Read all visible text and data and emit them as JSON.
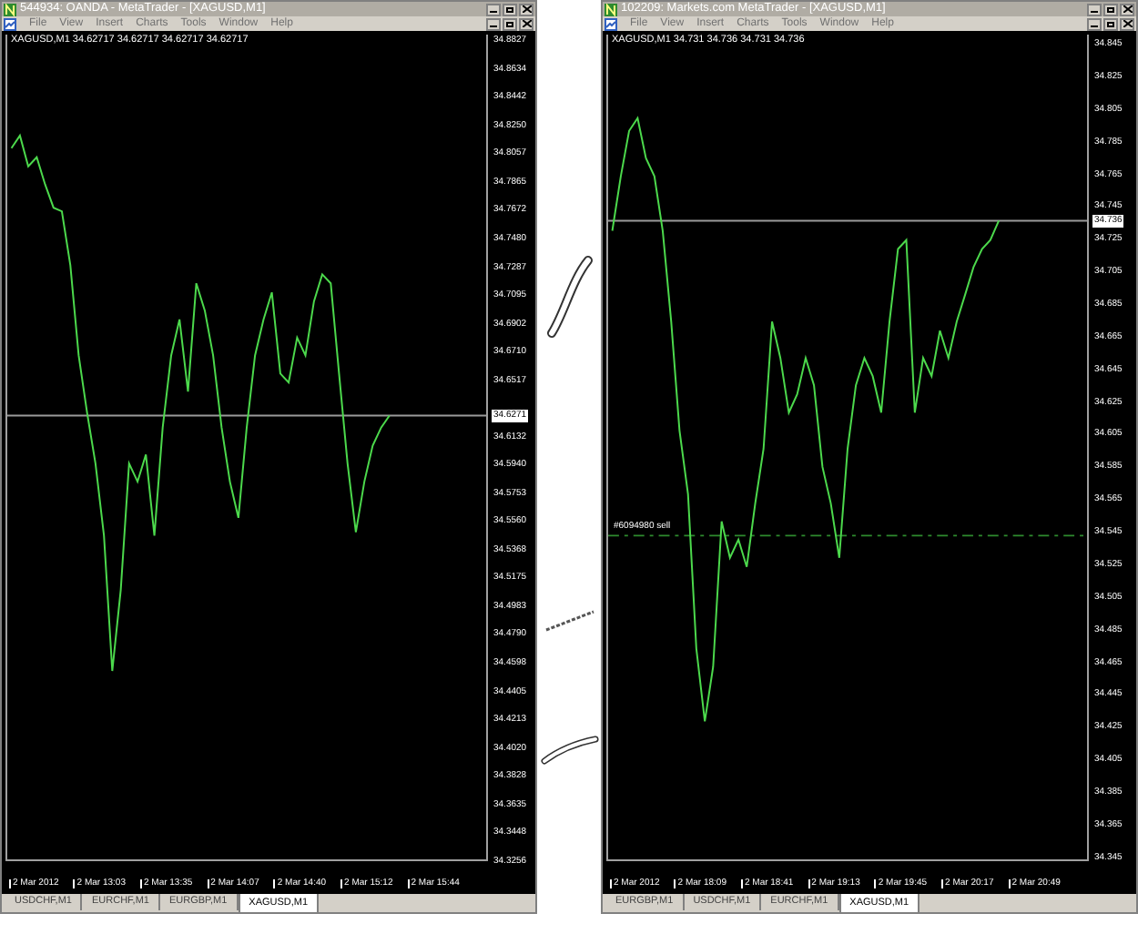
{
  "windows": [
    {
      "title": "544934: OANDA - MetaTrader - [XAGUSD,M1]",
      "menu": [
        "File",
        "View",
        "Insert",
        "Charts",
        "Tools",
        "Window",
        "Help"
      ],
      "chart_ohlc": "34.62717 34.62717 34.62717 34.62717",
      "time_labels": [
        "2 Mar 2012",
        "2 Mar 13:03",
        "2 Mar 13:35",
        "2 Mar 14:07",
        "2 Mar 14:40",
        "2 Mar 15:12",
        "2 Mar 15:44"
      ],
      "chart_data": {
        "type": "line",
        "ylim": [
          34.325,
          34.8864
        ],
        "ref_lines": [
          {
            "axis": "y",
            "value": 34.6271,
            "label": "34.6271",
            "color": "#9a9a9a"
          }
        ],
        "series": [
          {
            "name": "XAGUSD,M1",
            "color": "#4cd94c",
            "values": [
              34.8091,
              34.8177,
              34.7968,
              34.8029,
              34.7845,
              34.7686,
              34.7661,
              34.7293,
              34.668,
              34.6287,
              34.5944,
              34.5453,
              34.4532,
              34.5085,
              34.5944,
              34.5821,
              34.6005,
              34.5453,
              34.6189,
              34.668,
              34.6925,
              34.6434,
              34.7171,
              34.6986,
              34.668,
              34.6189,
              34.5821,
              34.5575,
              34.6189,
              34.668,
              34.6925,
              34.7109,
              34.6557,
              34.6496,
              34.6802,
              34.668,
              34.7048,
              34.7232,
              34.7171,
              34.6557,
              34.5944,
              34.5477,
              34.5821,
              34.6066,
              34.6189,
              34.6271
            ]
          }
        ],
        "yticks": [
          {
            "value": 34.8827,
            "label": "34.8827"
          },
          {
            "value": 34.8634,
            "label": "34.8634"
          },
          {
            "value": 34.8442,
            "label": "34.8442"
          },
          {
            "value": 34.825,
            "label": "34.8250"
          },
          {
            "value": 34.8057,
            "label": "34.8057"
          },
          {
            "value": 34.7865,
            "label": "34.7865"
          },
          {
            "value": 34.7672,
            "label": "34.7672"
          },
          {
            "value": 34.748,
            "label": "34.7480"
          },
          {
            "value": 34.7287,
            "label": "34.7287"
          },
          {
            "value": 34.7095,
            "label": "34.7095"
          },
          {
            "value": 34.6902,
            "label": "34.6902"
          },
          {
            "value": 34.671,
            "label": "34.6710"
          },
          {
            "value": 34.6517,
            "label": "34.6517"
          },
          {
            "value": 34.6132,
            "label": "34.6132"
          },
          {
            "value": 34.594,
            "label": "34.5940"
          },
          {
            "value": 34.5753,
            "label": "34.5753"
          },
          {
            "value": 34.556,
            "label": "34.5560"
          },
          {
            "value": 34.5368,
            "label": "34.5368"
          },
          {
            "value": 34.5175,
            "label": "34.5175"
          },
          {
            "value": 34.4983,
            "label": "34.4983"
          },
          {
            "value": 34.479,
            "label": "34.4790"
          },
          {
            "value": 34.4598,
            "label": "34.4598"
          },
          {
            "value": 34.4405,
            "label": "34.4405"
          },
          {
            "value": 34.4213,
            "label": "34.4213"
          },
          {
            "value": 34.402,
            "label": "34.4020"
          },
          {
            "value": 34.3828,
            "label": "34.3828"
          },
          {
            "value": 34.3635,
            "label": "34.3635"
          },
          {
            "value": 34.3448,
            "label": "34.3448"
          },
          {
            "value": 34.3256,
            "label": "34.3256"
          }
        ]
      },
      "tabs": [
        {
          "label": "USDCHF,M1",
          "selected": false
        },
        {
          "label": "EURCHF,M1",
          "selected": false
        },
        {
          "label": "EURGBP,M1",
          "selected": false
        },
        {
          "label": "XAGUSD,M1",
          "selected": true
        }
      ]
    },
    {
      "title": "102209: Markets.com MetaTrader - [XAGUSD,M1]",
      "menu": [
        "File",
        "View",
        "Insert",
        "Charts",
        "Tools",
        "Window",
        "Help"
      ],
      "chart_ohlc": "34.731 34.736 34.731 34.736",
      "time_labels": [
        "2 Mar 2012",
        "2 Mar 18:09",
        "2 Mar 18:41",
        "2 Mar 19:13",
        "2 Mar 19:45",
        "2 Mar 20:17",
        "2 Mar 20:49"
      ],
      "chart_data": {
        "type": "line",
        "ylim": [
          34.3426,
          34.8506
        ],
        "ref_lines": [
          {
            "axis": "y",
            "value": 34.736,
            "label": "34.736",
            "color": "#9a9a9a"
          },
          {
            "axis": "y",
            "value": 34.542,
            "label": "#6094980 sell",
            "color": "#2e8b2e"
          }
        ],
        "series": [
          {
            "name": "XAGUSD,M1",
            "color": "#4cd94c",
            "values": [
              34.7297,
              34.7633,
              34.7913,
              34.7991,
              34.7745,
              34.7633,
              34.7297,
              34.6738,
              34.6067,
              34.5675,
              34.4724,
              34.4276,
              34.4612,
              34.5507,
              34.5283,
              34.5395,
              34.5227,
              34.5619,
              34.5955,
              34.6738,
              34.6514,
              34.6178,
              34.629,
              34.6514,
              34.6346,
              34.5843,
              34.5619,
              34.5283,
              34.5955,
              34.6346,
              34.6514,
              34.6402,
              34.6178,
              34.6738,
              34.7186,
              34.7241,
              34.6178,
              34.6514,
              34.6402,
              34.6682,
              34.6514,
              34.6738,
              34.6906,
              34.7074,
              34.7186,
              34.7241,
              34.736
            ]
          }
        ],
        "yticks": [
          {
            "value": 34.845,
            "label": "34.845"
          },
          {
            "value": 34.825,
            "label": "34.825"
          },
          {
            "value": 34.805,
            "label": "34.805"
          },
          {
            "value": 34.785,
            "label": "34.785"
          },
          {
            "value": 34.765,
            "label": "34.765"
          },
          {
            "value": 34.745,
            "label": "34.745"
          },
          {
            "value": 34.725,
            "label": "34.725"
          },
          {
            "value": 34.705,
            "label": "34.705"
          },
          {
            "value": 34.685,
            "label": "34.685"
          },
          {
            "value": 34.665,
            "label": "34.665"
          },
          {
            "value": 34.645,
            "label": "34.645"
          },
          {
            "value": 34.625,
            "label": "34.625"
          },
          {
            "value": 34.605,
            "label": "34.605"
          },
          {
            "value": 34.585,
            "label": "34.585"
          },
          {
            "value": 34.565,
            "label": "34.565"
          },
          {
            "value": 34.545,
            "label": "34.545"
          },
          {
            "value": 34.525,
            "label": "34.525"
          },
          {
            "value": 34.505,
            "label": "34.505"
          },
          {
            "value": 34.485,
            "label": "34.485"
          },
          {
            "value": 34.465,
            "label": "34.465"
          },
          {
            "value": 34.445,
            "label": "34.445"
          },
          {
            "value": 34.425,
            "label": "34.425"
          },
          {
            "value": 34.405,
            "label": "34.405"
          },
          {
            "value": 34.385,
            "label": "34.385"
          },
          {
            "value": 34.365,
            "label": "34.365"
          },
          {
            "value": 34.345,
            "label": "34.345"
          }
        ]
      },
      "tabs": [
        {
          "label": "EURGBP,M1",
          "selected": false
        },
        {
          "label": "USDCHF,M1",
          "selected": false
        },
        {
          "label": "EURCHF,M1",
          "selected": false
        },
        {
          "label": "XAGUSD,M1",
          "selected": true
        }
      ]
    }
  ]
}
